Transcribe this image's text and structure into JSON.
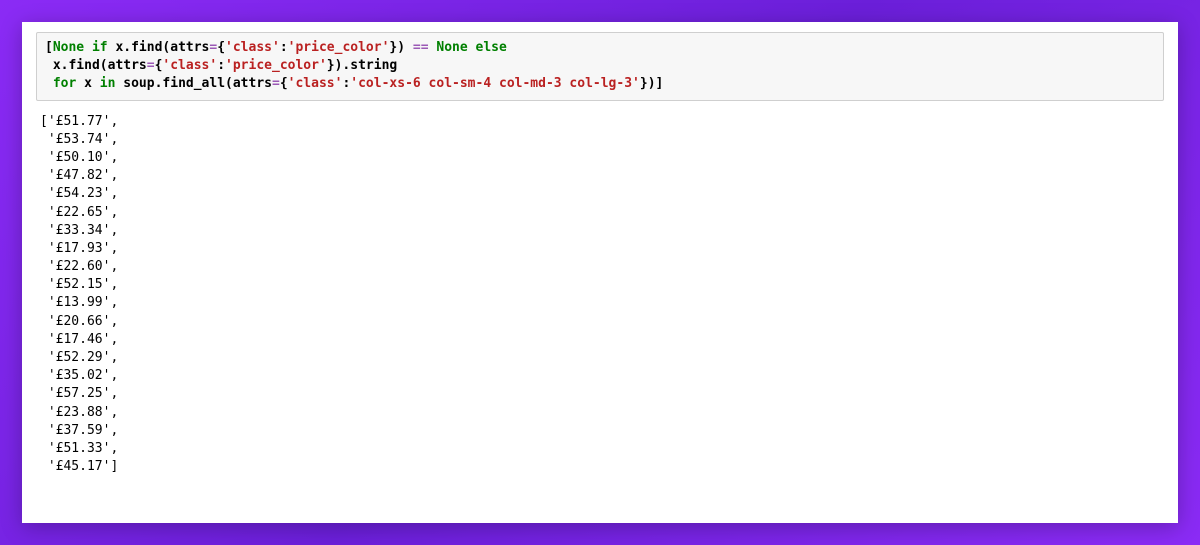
{
  "code": {
    "line1_a": "[",
    "line1_kw1": "None",
    "line1_b": " ",
    "line1_kw2": "if",
    "line1_c": " x.find(attrs",
    "line1_eq1": "=",
    "line1_d": "{",
    "line1_str1": "'class'",
    "line1_e": ":",
    "line1_str2": "'price_color'",
    "line1_f": "}) ",
    "line1_eq2": "==",
    "line1_g": " ",
    "line1_kw3": "None",
    "line1_h": " ",
    "line1_kw4": "else",
    "line2_a": " x.find(attrs",
    "line2_eq1": "=",
    "line2_b": "{",
    "line2_str1": "'class'",
    "line2_c": ":",
    "line2_str2": "'price_color'",
    "line2_d": "}).string",
    "line3_a": " ",
    "line3_kw1": "for",
    "line3_b": " x ",
    "line3_kw2": "in",
    "line3_c": " soup.find_all(attrs",
    "line3_eq1": "=",
    "line3_d": "{",
    "line3_str1": "'class'",
    "line3_e": ":",
    "line3_str2": "'col-xs-6 col-sm-4 col-md-3 col-lg-3'",
    "line3_f": "})]"
  },
  "output": {
    "prices": [
      "£51.77",
      "£53.74",
      "£50.10",
      "£47.82",
      "£54.23",
      "£22.65",
      "£33.34",
      "£17.93",
      "£22.60",
      "£52.15",
      "£13.99",
      "£20.66",
      "£17.46",
      "£52.29",
      "£35.02",
      "£57.25",
      "£23.88",
      "£37.59",
      "£51.33",
      "£45.17"
    ]
  }
}
